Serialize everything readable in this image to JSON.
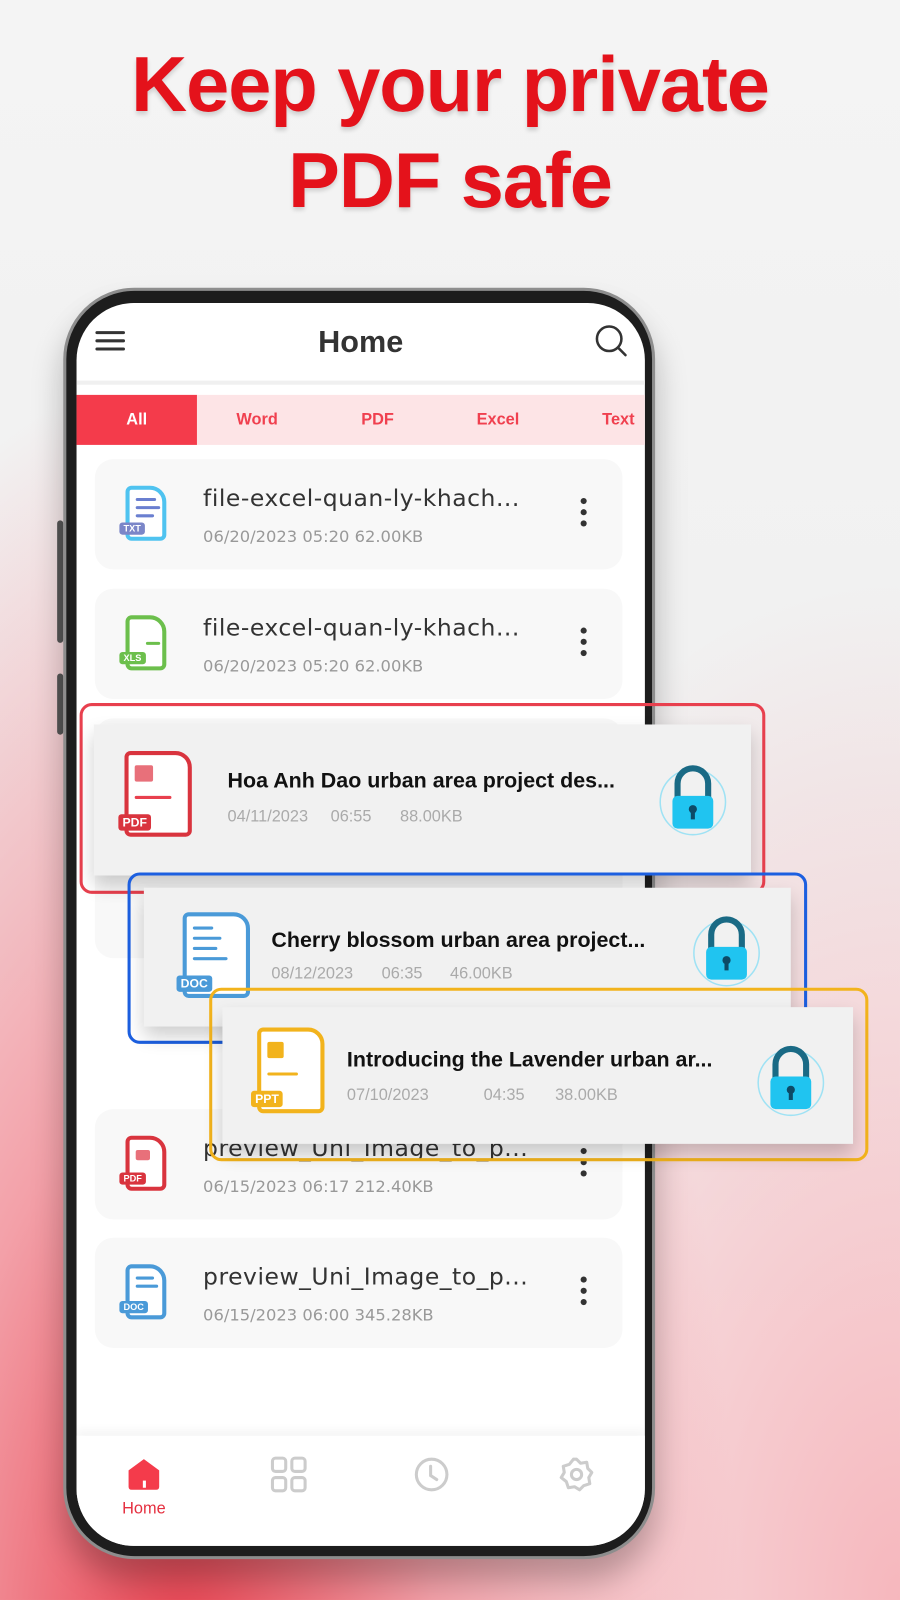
{
  "headline": {
    "line1": "Keep your private",
    "line2": "PDF safe"
  },
  "app": {
    "title": "Home",
    "menu_icon": "hamburger-menu-icon",
    "search_icon": "search-icon"
  },
  "tabs": [
    {
      "label": "All",
      "active": true
    },
    {
      "label": "Word"
    },
    {
      "label": "PDF"
    },
    {
      "label": "Excel"
    },
    {
      "label": "Text"
    }
  ],
  "files": [
    {
      "name": "file-excel-quan-ly-khach...",
      "meta": "06/20/2023 05:20   62.00KB",
      "type": "TXT"
    },
    {
      "name": "file-excel-quan-ly-khach...",
      "meta": "06/20/2023 05:20   62.00KB",
      "type": "XLS"
    },
    {
      "name": "preview_Uni_Image_to_p...",
      "meta": "06/15/2023 06:17   212.40KB",
      "type": "PDF"
    },
    {
      "name": "preview_Uni_Image_to_p...",
      "meta": "06/15/2023 06:00   345.28KB",
      "type": "DOC"
    }
  ],
  "locked_files": [
    {
      "name": "Hoa Anh Dao urban area project des...",
      "date": "04/11/2023",
      "time": "06:55",
      "size": "88.00KB",
      "type": "PDF",
      "color": "#e8404e"
    },
    {
      "name": "Cherry blossom urban area project...",
      "date": "08/12/2023",
      "time": "06:35",
      "size": "46.00KB",
      "type": "DOC",
      "color": "#1c5fe0"
    },
    {
      "name": "Introducing the Lavender urban ar...",
      "date": "07/10/2023",
      "time": "04:35",
      "size": "38.00KB",
      "type": "PPT",
      "color": "#f2b31c"
    }
  ],
  "nav": [
    {
      "label": "Home",
      "icon": "home-icon",
      "active": true
    },
    {
      "icon": "grid-icon"
    },
    {
      "icon": "clock-icon"
    },
    {
      "icon": "gear-icon"
    }
  ],
  "colors": {
    "accent": "#f43b4b",
    "headline": "#e4121b"
  }
}
